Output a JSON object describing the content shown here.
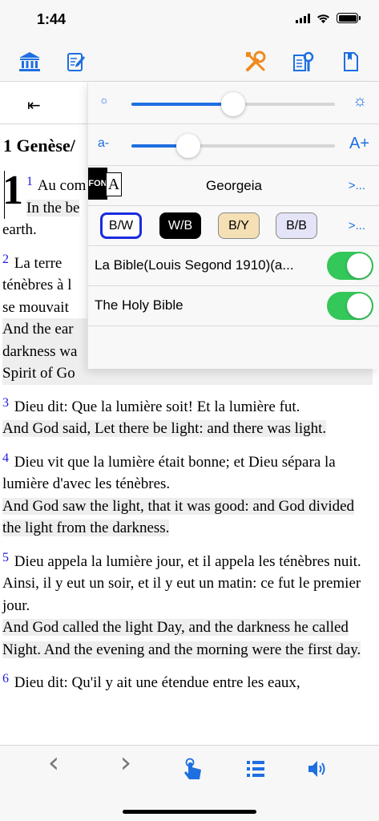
{
  "status_bar": {
    "time": "1:44"
  },
  "toolbar": {
    "icons": [
      "library-icon",
      "notes-icon",
      "tools-icon",
      "search-book-icon",
      "bookmark-icon"
    ]
  },
  "reader": {
    "back_symbol": "⇤",
    "chapter_title": "1 Genèse/",
    "drop_number": "1",
    "verses": [
      {
        "num": "1",
        "fr": "Au com",
        "en": "In the be",
        "en_tail": "earth."
      },
      {
        "num": "2",
        "fr_lines": [
          "La terre",
          "ténèbres à l",
          "se mouvait"
        ],
        "en_lines": [
          "And the ear",
          "darkness wa",
          "Spirit of Go"
        ]
      },
      {
        "num": "3",
        "fr": "Dieu dit: Que la lumière soit! Et la lumière fut.",
        "en": "And God said, Let there be light: and there was light."
      },
      {
        "num": "4",
        "fr": "Dieu vit que la lumière était bonne; et Dieu sépara la lumière d'avec les ténèbres.",
        "en": "And God saw the light, that it was good: and God divided the light from the darkness."
      },
      {
        "num": "5",
        "fr": "Dieu appela la lumière jour, et il appela les ténèbres nuit. Ainsi, il y eut un soir, et il y eut un matin: ce fut le premier jour.",
        "en": "And God called the light Day, and the darkness he called Night. And the evening and the morning were the first day."
      },
      {
        "num": "6",
        "fr": "Dieu dit: Qu'il y ait une étendue entre les eaux,"
      }
    ]
  },
  "settings": {
    "brightness": {
      "value": 0.5,
      "min_icon": "☼",
      "max_icon": "☼"
    },
    "font_size": {
      "value": 0.28,
      "min_label": "a-",
      "max_label": "A+"
    },
    "font": {
      "icon_text_1": "FON",
      "icon_text_2": "A",
      "name": "Georgeia",
      "more": ">..."
    },
    "themes": [
      {
        "label": "B/W",
        "bg": "#ffffff",
        "fg": "#000000",
        "selected": true
      },
      {
        "label": "W/B",
        "bg": "#000000",
        "fg": "#ffffff",
        "selected": false
      },
      {
        "label": "B/Y",
        "bg": "#f5dfb5",
        "fg": "#000000",
        "selected": false
      },
      {
        "label": "B/B",
        "bg": "#e3e4f7",
        "fg": "#000000",
        "selected": false
      }
    ],
    "themes_more": ">...",
    "bibles": [
      {
        "label": "La Bible(Louis Segond 1910)(a...",
        "enabled": true
      },
      {
        "label": "The Holy Bible",
        "enabled": true
      }
    ]
  },
  "bottom_bar": {
    "icons": [
      "previous-chapter-icon",
      "next-chapter-icon",
      "tap-icon",
      "list-icon",
      "speaker-icon"
    ],
    "prev": "‹",
    "next": "›"
  },
  "colors": {
    "accent": "#1e6fe0",
    "orange": "#f08a1e",
    "toggle_on": "#34c759"
  }
}
